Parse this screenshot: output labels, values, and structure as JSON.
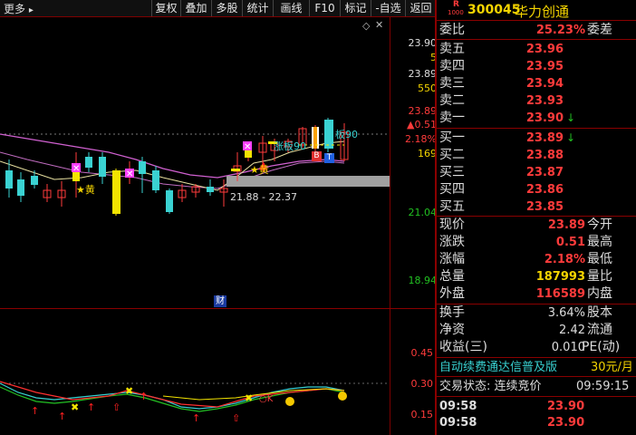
{
  "toolbar": {
    "more_label": "更多",
    "buttons": [
      "复权",
      "叠加",
      "多股",
      "统计",
      "画线",
      "F10",
      "标记",
      "-自选",
      "返回"
    ]
  },
  "chart": {
    "price_axis": [
      "23.90",
      "5",
      "23.89",
      "550",
      "23.89",
      "▲0.51",
      "2.18%",
      "169",
      "21.04",
      "18.94"
    ],
    "range_label": "21.88 - 22.37",
    "annot_limit": "板90",
    "annot_limit2": "涨板90",
    "annot_star1": "★黄",
    "annot_star2": "★黄",
    "marker_b": "B",
    "marker_t": "T",
    "marker_cai": "财",
    "ind_axis": [
      "0.45",
      "0.30",
      "0.15"
    ]
  },
  "header": {
    "badge_r": "R",
    "badge_num": "1000",
    "code": "300045",
    "name": "华力创通"
  },
  "weibi": {
    "label": "委比",
    "value": "25.23%",
    "right": "委差"
  },
  "sells": [
    {
      "label": "卖五",
      "price": "23.96"
    },
    {
      "label": "卖四",
      "price": "23.95"
    },
    {
      "label": "卖三",
      "price": "23.94"
    },
    {
      "label": "卖二",
      "price": "23.93"
    },
    {
      "label": "卖一",
      "price": "23.90"
    }
  ],
  "buys": [
    {
      "label": "买一",
      "price": "23.89"
    },
    {
      "label": "买二",
      "price": "23.88"
    },
    {
      "label": "买三",
      "price": "23.87"
    },
    {
      "label": "买四",
      "price": "23.86"
    },
    {
      "label": "买五",
      "price": "23.85"
    }
  ],
  "stats": [
    {
      "label": "现价",
      "value": "23.89",
      "right": "今开",
      "color": "red"
    },
    {
      "label": "涨跌",
      "value": "0.51",
      "right": "最高",
      "color": "red"
    },
    {
      "label": "涨幅",
      "value": "2.18%",
      "right": "最低",
      "color": "red"
    },
    {
      "label": "总量",
      "value": "187993",
      "right": "量比",
      "color": "yellow"
    },
    {
      "label": "外盘",
      "value": "116589",
      "right": "内盘",
      "color": "red"
    }
  ],
  "stats2": [
    {
      "label": "换手",
      "value": "3.64%",
      "right": "股本"
    },
    {
      "label": "净资",
      "value": "2.42",
      "right": "流通"
    },
    {
      "label": "收益(三)",
      "value": "0.010",
      "right": "PE(动)"
    }
  ],
  "ad": {
    "text": "自动续费通达信普及版",
    "price": "30元/月"
  },
  "trade_status": {
    "label": "交易状态: 连续竞价",
    "time": "09:59:15"
  },
  "ticks": [
    {
      "time": "09:58",
      "price": "23.90"
    },
    {
      "time": "09:58",
      "price": "23.90"
    },
    {
      "time": "",
      "price": ""
    }
  ]
}
